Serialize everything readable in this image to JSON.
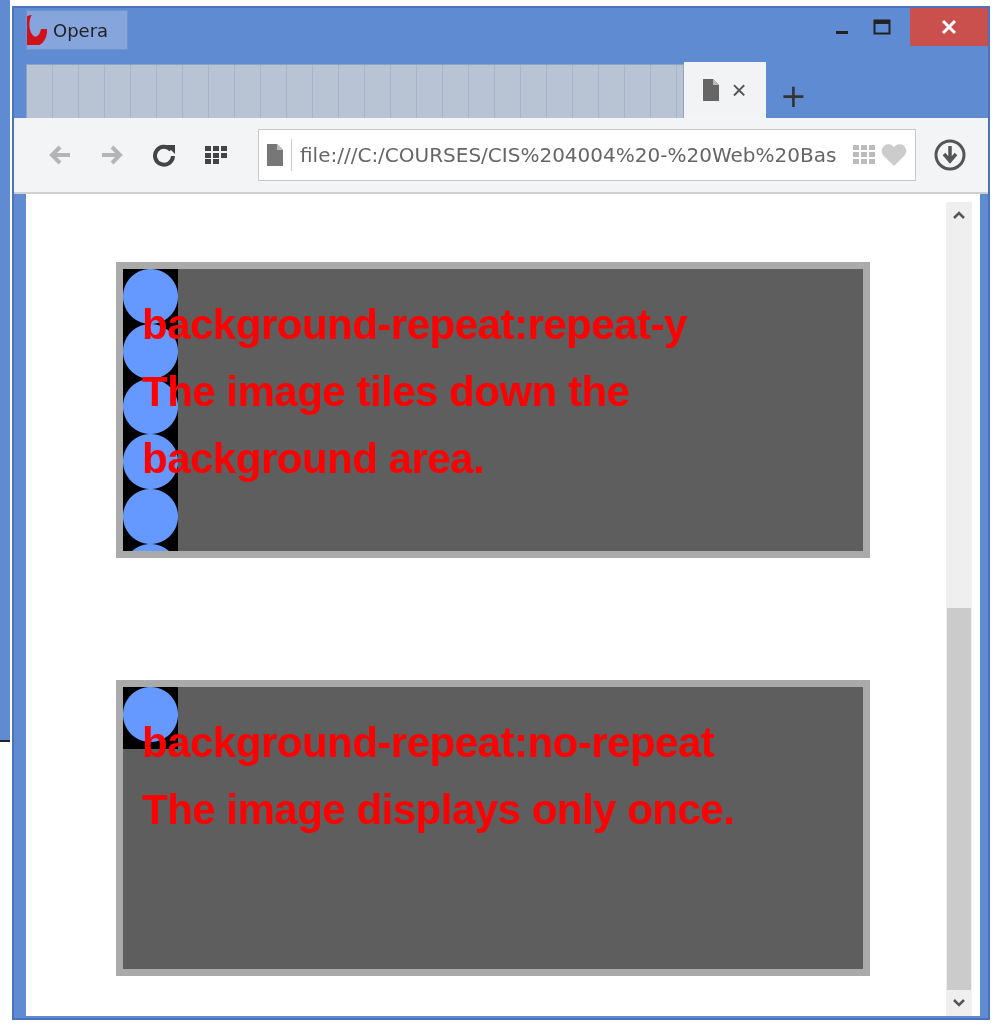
{
  "window": {
    "title": "Opera"
  },
  "tabs": [
    {
      "close": "×",
      "selected": true
    }
  ],
  "new_tab": "+",
  "toolbar": {
    "back_disabled": true,
    "forward_disabled": true
  },
  "address_bar": {
    "value": "file:///C:/COURSES/CIS%204004%20-%20Web%20Bas"
  },
  "examples": [
    {
      "kind": "repeat-y",
      "heading": "background-repeat:repeat-y",
      "description": "The image tiles down the background area."
    },
    {
      "kind": "no-repeat",
      "heading": "background-repeat:no-repeat",
      "description": "The image displays only once."
    }
  ]
}
